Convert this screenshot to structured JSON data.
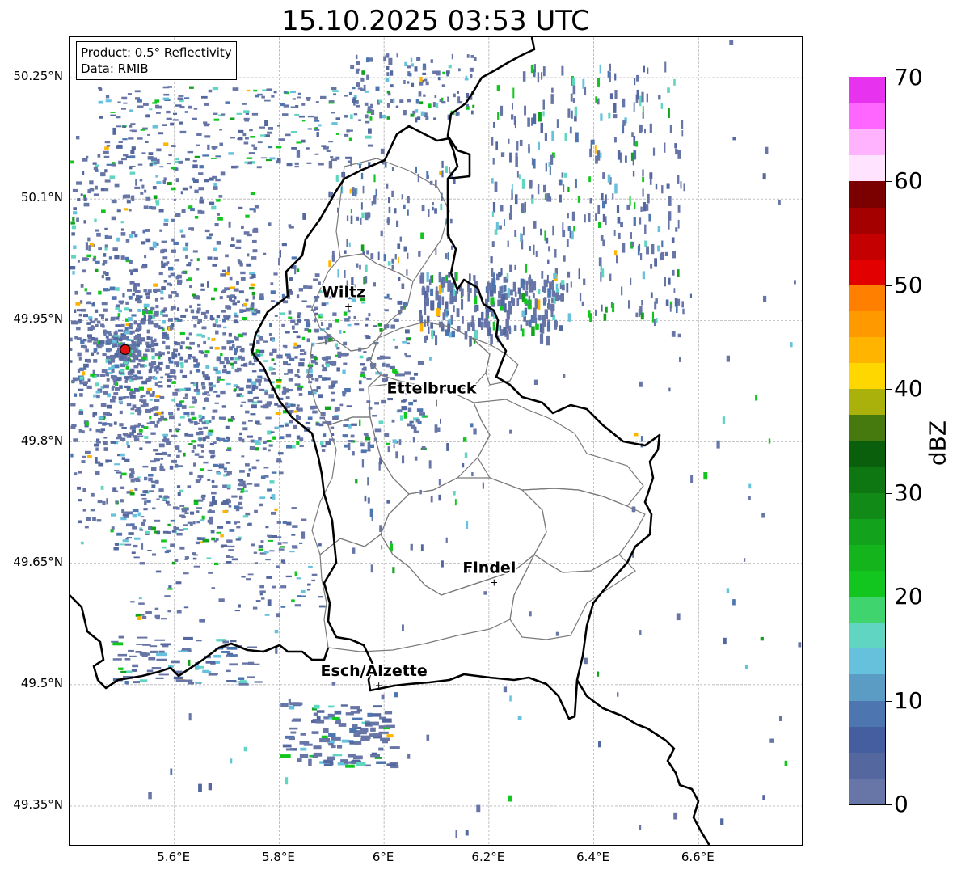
{
  "title": "15.10.2025 03:53 UTC",
  "info": {
    "product": "Product: 0.5° Reflectivity",
    "data_source": "Data: RMIB"
  },
  "lat_labels": [
    "50.25°N",
    "50.1°N",
    "49.95°N",
    "49.8°N",
    "49.65°N",
    "49.5°N",
    "49.35°N"
  ],
  "lat_values": [
    50.25,
    50.1,
    49.95,
    49.8,
    49.65,
    49.5,
    49.35
  ],
  "lon_labels": [
    "5.6°E",
    "5.8°E",
    "6°E",
    "6.2°E",
    "6.4°E",
    "6.6°E"
  ],
  "lon_values": [
    5.6,
    5.8,
    6.0,
    6.2,
    6.4,
    6.6
  ],
  "extent": {
    "lon_min": 5.4,
    "lon_max": 6.8,
    "lat_min": 49.3,
    "lat_max": 50.3
  },
  "cities": [
    {
      "name": "Wiltz",
      "lon": 5.932,
      "lat": 49.967
    },
    {
      "name": "Ettelbruck",
      "lon": 6.1,
      "lat": 49.848
    },
    {
      "name": "Findel",
      "lon": 6.21,
      "lat": 49.626
    },
    {
      "name": "Esch/Alzette",
      "lon": 5.99,
      "lat": 49.499
    }
  ],
  "radar_site": {
    "lon": 5.506,
    "lat": 49.914,
    "color": "#e01010"
  },
  "colorbar": {
    "label": "dBZ",
    "min": 0,
    "max": 70,
    "tick_labels": [
      "0",
      "10",
      "20",
      "30",
      "40",
      "50",
      "60",
      "70"
    ],
    "tick_values": [
      0,
      10,
      20,
      30,
      40,
      50,
      60,
      70
    ],
    "step": 2.5,
    "colors": [
      "#6775a7",
      "#54679e",
      "#445e9f",
      "#4d76b0",
      "#5b9cc5",
      "#66c1dd",
      "#60d5c1",
      "#3fd46d",
      "#13c61f",
      "#14b41d",
      "#12a21b",
      "#128a18",
      "#0f7712",
      "#0a5f0c",
      "#477a0e",
      "#aab10a",
      "#ffd700",
      "#ffb400",
      "#ff9900",
      "#ff7f00",
      "#e30000",
      "#c40000",
      "#a40000",
      "#7b0000",
      "#ffe3ff",
      "#ffb3ff",
      "#ff66ff",
      "#e733f0"
    ]
  },
  "colors": {
    "border": "#000000",
    "canton_border": "#7a7a7a",
    "grid": "#b4b4b4"
  }
}
